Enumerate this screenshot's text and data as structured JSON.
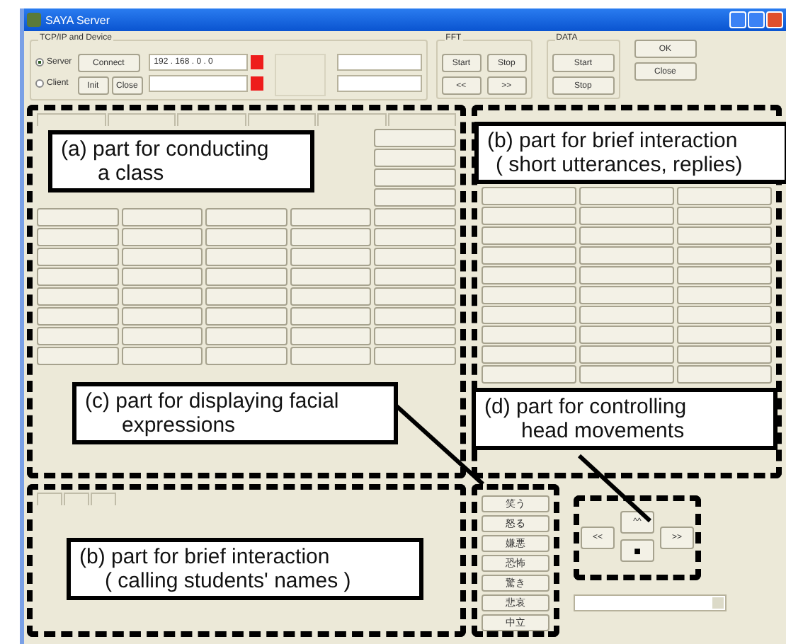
{
  "window": {
    "title": "SAYA Server"
  },
  "connection": {
    "group_title": "TCP/IP and Device",
    "modes": [
      {
        "label": "Server",
        "selected": true
      },
      {
        "label": "Client",
        "selected": false
      }
    ],
    "buttons": [
      "Connect",
      "Init",
      "Close"
    ],
    "address": "192 . 168 . 0 . 0"
  },
  "fft": {
    "group_title": "FFT",
    "buttons": [
      "Start",
      "Stop",
      "<<",
      ">>"
    ]
  },
  "data": {
    "group_title": "DATA",
    "buttons": [
      "Start",
      "Stop"
    ]
  },
  "dialog_buttons": [
    "OK",
    "Close"
  ],
  "expression_buttons": [
    "笑う",
    "怒る",
    "嫌悪",
    "恐怖",
    "驚き",
    "悲哀",
    "中立"
  ],
  "head_buttons": [
    {
      "kind": "left",
      "label": "<<"
    },
    {
      "kind": "up",
      "label": "^^"
    },
    {
      "kind": "right",
      "label": ">>"
    },
    {
      "kind": "stop",
      "label": "■"
    }
  ],
  "annotations": [
    {
      "text": "(a)  part for conducting\na class"
    },
    {
      "text": "(b) part for brief interaction\n( short utterances, replies)"
    },
    {
      "text": "(c) part for displaying facial\nexpressions"
    },
    {
      "text": "(d) part for controlling\nhead movements"
    },
    {
      "text": "(b) part for brief interaction\n( calling students' names )"
    }
  ]
}
